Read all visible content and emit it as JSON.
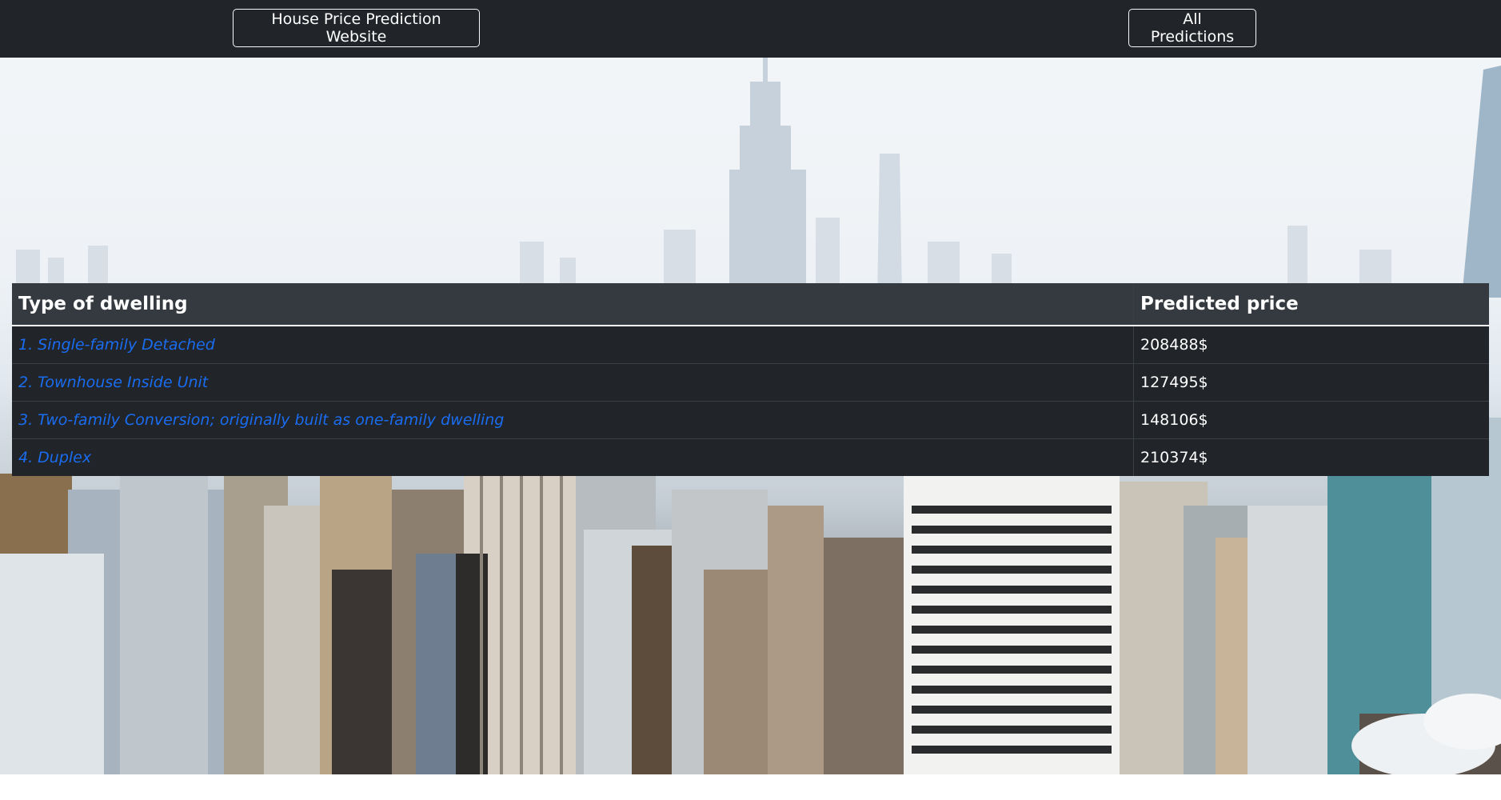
{
  "navbar": {
    "brand_label": "House Price Prediction Website",
    "all_predictions_label": "All Predictions"
  },
  "table": {
    "headers": [
      "Type of dwelling",
      "Predicted price"
    ],
    "rows": [
      {
        "dwelling": "1. Single-family Detached",
        "price": "208488$"
      },
      {
        "dwelling": "2. Townhouse Inside Unit",
        "price": "127495$"
      },
      {
        "dwelling": "3. Two-family Conversion; originally built as one-family dwelling",
        "price": "148106$"
      },
      {
        "dwelling": "4. Duplex",
        "price": "210374$"
      }
    ]
  },
  "colors": {
    "navbar_bg": "#212529",
    "table_header_bg": "#343a40",
    "table_row_bg": "#212529",
    "link": "#1a6cf0"
  },
  "background": {
    "image": "city-skyline-photo"
  }
}
